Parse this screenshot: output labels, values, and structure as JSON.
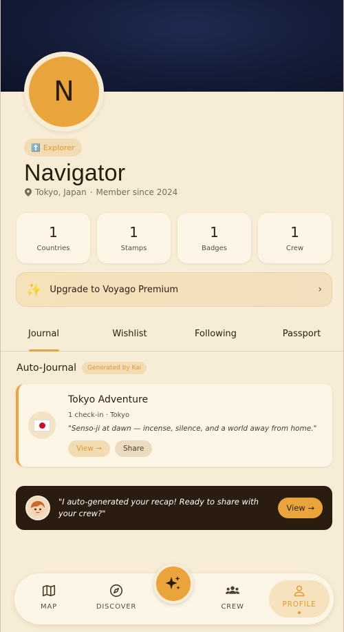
{
  "profile": {
    "avatar_initial": "N",
    "rank_icon": "⬆️",
    "rank_label": "Explorer",
    "name": "Navigator",
    "location": "Tokyo, Japan",
    "separator": "·",
    "member_since": "Member since 2024"
  },
  "stats": [
    {
      "value": "1",
      "label": "Countries"
    },
    {
      "value": "1",
      "label": "Stamps"
    },
    {
      "value": "1",
      "label": "Badges"
    },
    {
      "value": "1",
      "label": "Crew"
    }
  ],
  "upgrade": {
    "icon": "✨",
    "label": "Upgrade to Voyago Premium",
    "chevron": "›"
  },
  "tabs": [
    {
      "label": "Journal",
      "active": true
    },
    {
      "label": "Wishlist",
      "active": false
    },
    {
      "label": "Following",
      "active": false
    },
    {
      "label": "Passport",
      "active": false
    }
  ],
  "auto_journal": {
    "title": "Auto-Journal",
    "badge": "Generated by Kai"
  },
  "journal_card": {
    "title": "Tokyo Adventure",
    "subtitle": "1 check-in · Tokyo",
    "quote": "\"Senso-ji at dawn — incense, silence, and a world away from home.\"",
    "view_label": "View →",
    "share_label": "Share",
    "flag_icon": "japan-flag-icon"
  },
  "recap": {
    "text": "\"I auto-generated your recap! Ready to share with your crew?\"",
    "view_label": "View →"
  },
  "nav": {
    "map": "MAP",
    "discover": "DISCOVER",
    "crew": "CREW",
    "profile": "PROFILE"
  },
  "colors": {
    "accent": "#e9a43c",
    "background": "#f7ecd6",
    "header": "#141c38",
    "dark_card": "#2a1d10"
  }
}
